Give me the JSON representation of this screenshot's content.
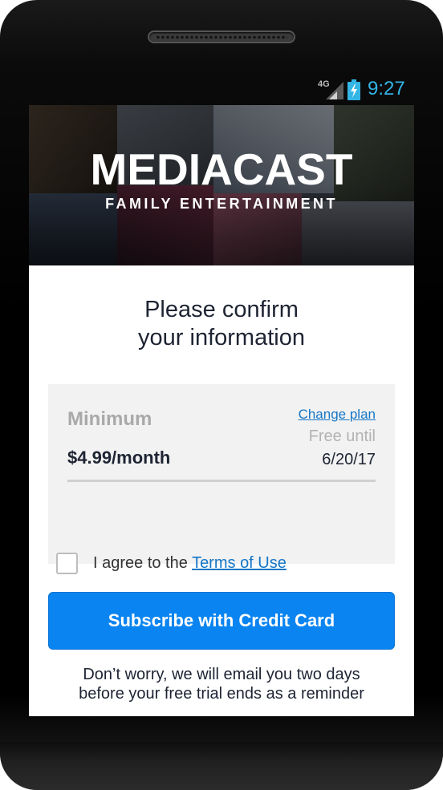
{
  "status_bar": {
    "network": "4G",
    "time": "9:27",
    "signal_icon": "signal-icon",
    "battery_icon": "battery-charging-icon",
    "clock_color": "#33b5e5"
  },
  "hero": {
    "brand_name": "MEDIACAST",
    "tagline": "FAMILY ENTERTAINMENT"
  },
  "headline": {
    "line1": "Please confirm",
    "line2": "your information"
  },
  "plan": {
    "name": "Minimum",
    "price": "$4.99/month",
    "change_plan_label": "Change plan",
    "free_until_label": "Free until",
    "free_until_date": "6/20/17"
  },
  "agreement": {
    "prefix": "I agree to the ",
    "terms_label": "Terms of Use",
    "checked": false
  },
  "subscribe": {
    "label": "Subscribe with Credit Card",
    "color": "#0a84f0"
  },
  "reminder": {
    "line1": "Don’t worry, we will email you two days",
    "line2": "before your free trial ends as a reminder"
  }
}
